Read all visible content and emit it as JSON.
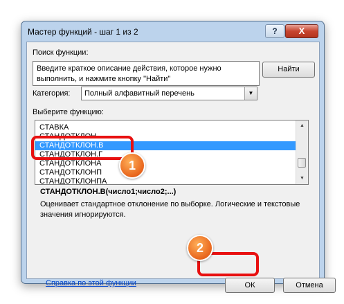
{
  "window": {
    "title": "Мастер функций - шаг 1 из 2",
    "help_button": "?",
    "close_button": "X"
  },
  "search": {
    "label": "Поиск функции:",
    "text": "Введите краткое описание действия, которое нужно выполнить, и нажмите кнопку \"Найти\"",
    "find_button": "Найти"
  },
  "category": {
    "label": "Категория:",
    "selected": "Полный алфавитный перечень"
  },
  "function_list": {
    "label": "Выберите функцию:",
    "items": [
      "СТАВКА",
      "СТАНДОТКЛОН",
      "СТАНДОТКЛОН.В",
      "СТАНДОТКЛОН.Г",
      "СТАНДОТКЛОНА",
      "СТАНДОТКЛОНП",
      "СТАНДОТКЛОНПА"
    ],
    "selected": "СТАНДОТКЛОН.В"
  },
  "syntax": "СТАНДОТКЛОН.В(число1;число2;...)",
  "description": "Оценивает стандартное отклонение по выборке. Логические и текстовые значения игнорируются.",
  "help_link": "Справка по этой функции",
  "buttons": {
    "ok": "ОК",
    "cancel": "Отмена"
  },
  "annotations": {
    "badge_1": "1",
    "badge_2": "2",
    "highlight_color": "#e81010",
    "badge_color": "#e8651c"
  },
  "colors": {
    "selection": "#3399ff",
    "window_frame": "#bcd3ec"
  }
}
